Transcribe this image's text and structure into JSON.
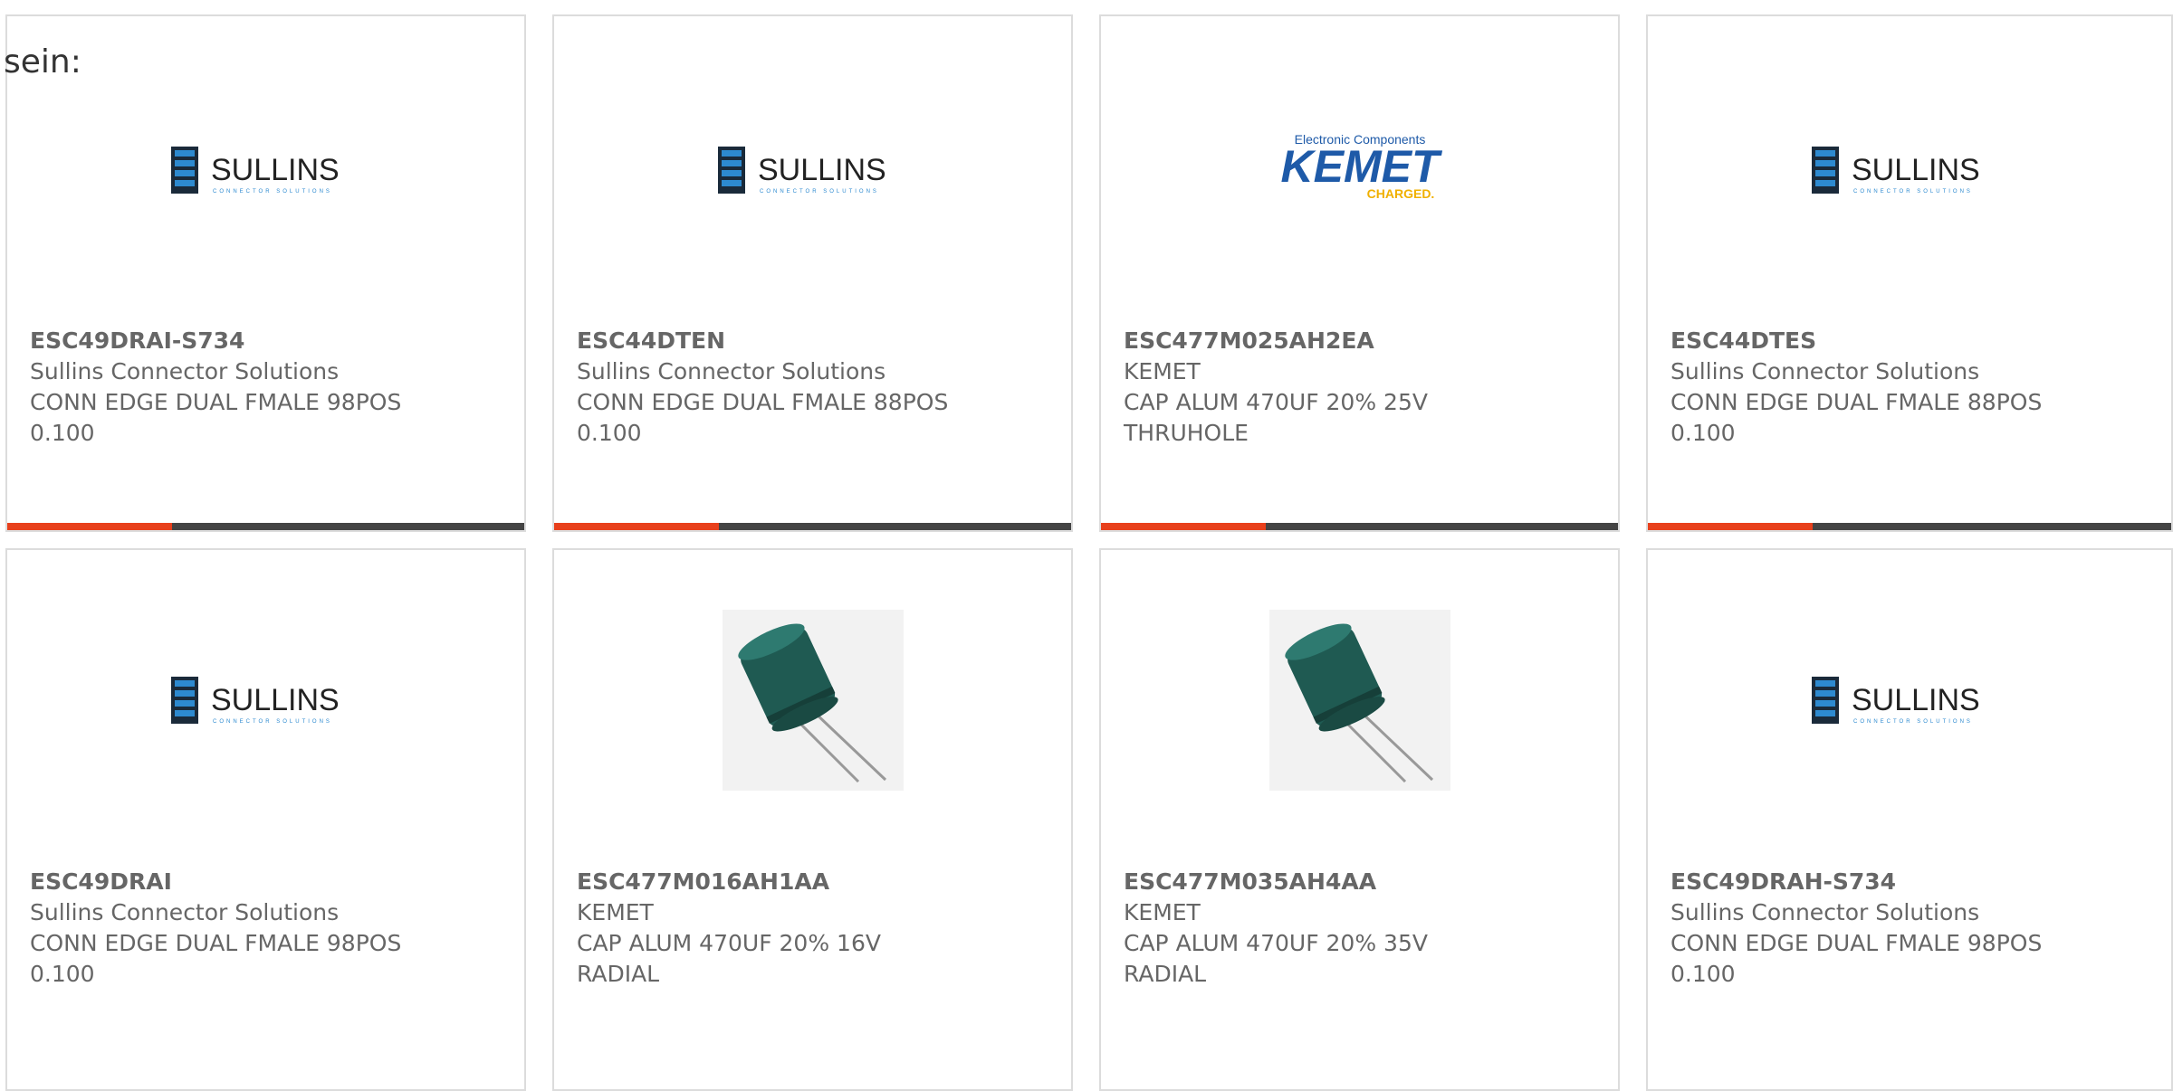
{
  "lead_text": "sein:",
  "colors": {
    "accent": "#e8401c",
    "bar": "#444444",
    "border": "#dcdcdc",
    "text": "#666666"
  },
  "products": [
    {
      "part": "ESC49DRAI-S734",
      "maker": "Sullins Connector Solutions",
      "desc1": "CONN EDGE DUAL FMALE 98POS",
      "desc2": "0.100",
      "logo": "sullins-logo",
      "logo_text": "SULLINS",
      "logo_sub": "CONNECTOR SOLUTIONS"
    },
    {
      "part": "ESC44DTEN",
      "maker": "Sullins Connector Solutions",
      "desc1": "CONN EDGE DUAL FMALE 88POS",
      "desc2": "0.100",
      "logo": "sullins-logo",
      "logo_text": "SULLINS",
      "logo_sub": "CONNECTOR SOLUTIONS"
    },
    {
      "part": "ESC477M025AH2EA",
      "maker": "KEMET",
      "desc1": "CAP ALUM 470UF 20% 25V",
      "desc2": "THRUHOLE",
      "logo": "kemet-logo",
      "logo_top": "Electronic Components",
      "logo_text": "KEMET",
      "logo_sub": "CHARGED."
    },
    {
      "part": "ESC44DTES",
      "maker": "Sullins Connector Solutions",
      "desc1": "CONN EDGE DUAL FMALE 88POS",
      "desc2": "0.100",
      "logo": "sullins-logo",
      "logo_text": "SULLINS",
      "logo_sub": "CONNECTOR SOLUTIONS"
    },
    {
      "part": "ESC49DRAI",
      "maker": "Sullins Connector Solutions",
      "desc1": "CONN EDGE DUAL FMALE 98POS",
      "desc2": "0.100",
      "logo": "sullins-logo",
      "logo_text": "SULLINS",
      "logo_sub": "CONNECTOR SOLUTIONS"
    },
    {
      "part": "ESC477M016AH1AA",
      "maker": "KEMET",
      "desc1": "CAP ALUM 470UF 20% 16V",
      "desc2": "RADIAL",
      "logo": "capacitor-photo"
    },
    {
      "part": "ESC477M035AH4AA",
      "maker": "KEMET",
      "desc1": "CAP ALUM 470UF 20% 35V",
      "desc2": "RADIAL",
      "logo": "capacitor-photo"
    },
    {
      "part": "ESC49DRAH-S734",
      "maker": "Sullins Connector Solutions",
      "desc1": "CONN EDGE DUAL FMALE 98POS",
      "desc2": "0.100",
      "logo": "sullins-logo",
      "logo_text": "SULLINS",
      "logo_sub": "CONNECTOR SOLUTIONS"
    }
  ]
}
